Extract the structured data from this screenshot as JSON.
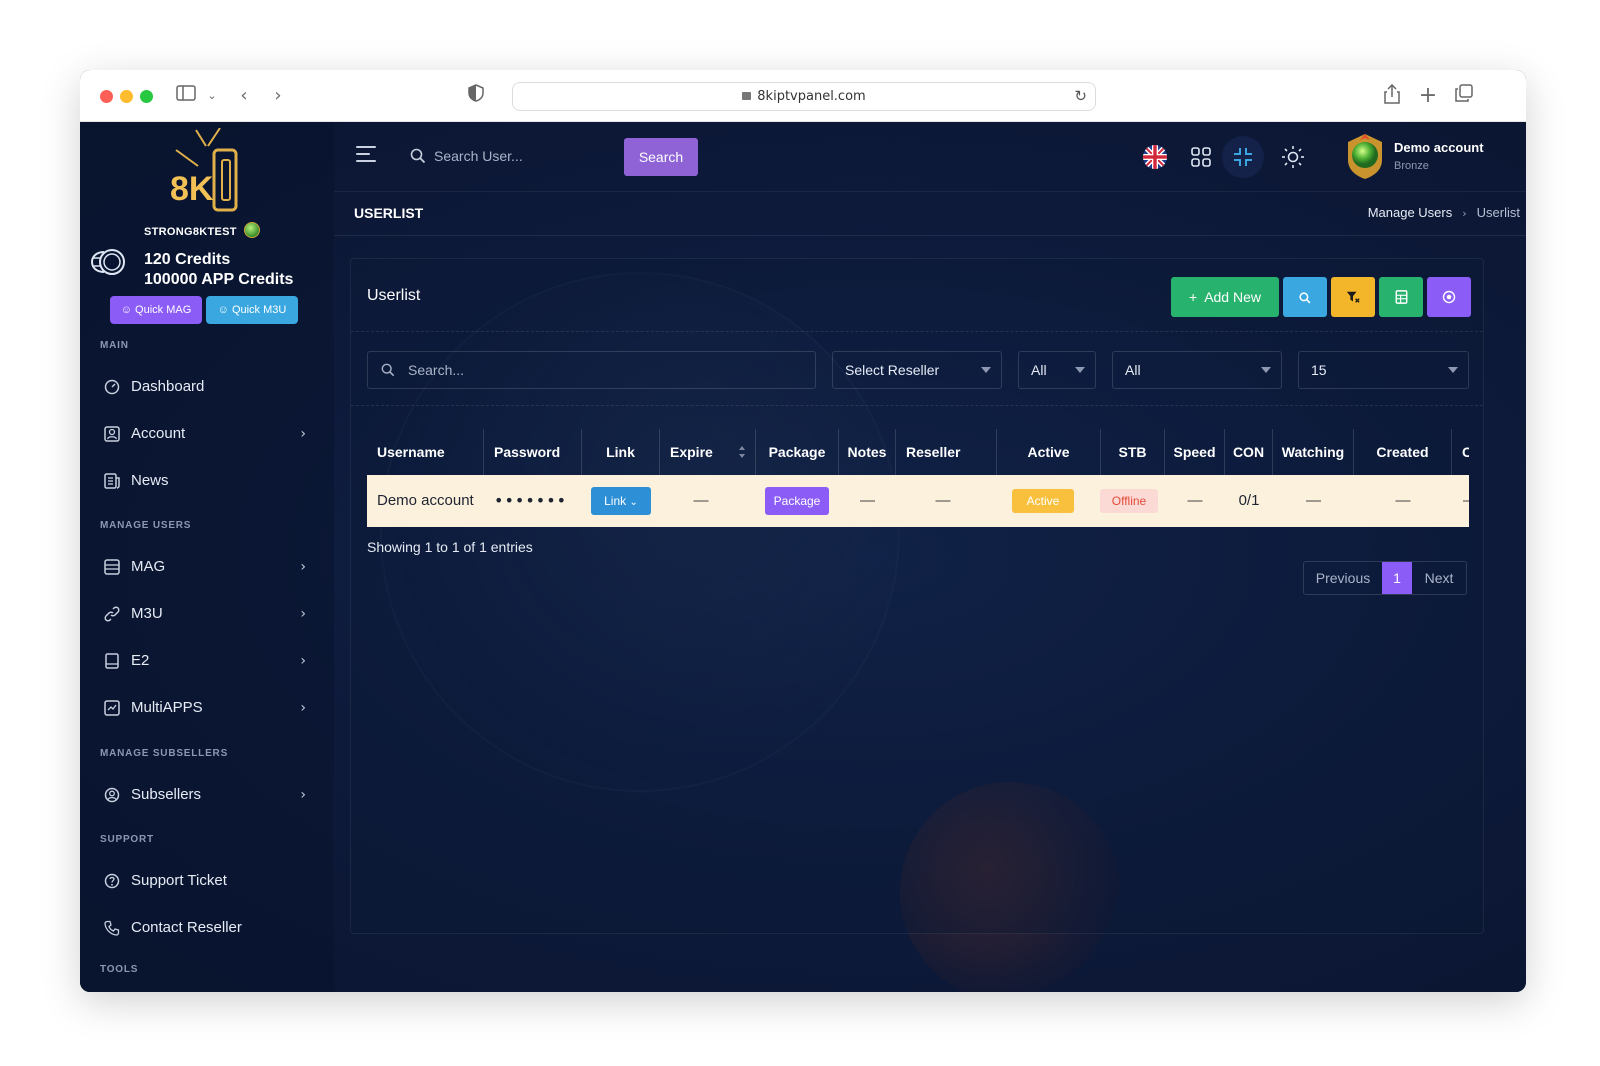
{
  "browser": {
    "url": "8kiptvpanel.com"
  },
  "sidebar": {
    "logo_text": "8K",
    "brand": "STRONG8KTEST",
    "credits": "120 Credits",
    "app_credits": "100000 APP Credits",
    "quick_mag": "Quick MAG",
    "quick_m3u": "Quick M3U",
    "sections": {
      "main": "MAIN",
      "manage_users": "MANAGE USERS",
      "manage_subsellers": "MANAGE SUBSELLERS",
      "support": "SUPPORT",
      "tools": "TOOLS"
    },
    "items": [
      {
        "label": "Dashboard",
        "icon": "dashboard-icon",
        "has_children": false
      },
      {
        "label": "Account",
        "icon": "account-icon",
        "has_children": true
      },
      {
        "label": "News",
        "icon": "news-icon",
        "has_children": false
      },
      {
        "label": "MAG",
        "icon": "mag-icon",
        "has_children": true
      },
      {
        "label": "M3U",
        "icon": "link-icon",
        "has_children": true
      },
      {
        "label": "E2",
        "icon": "e2-icon",
        "has_children": true
      },
      {
        "label": "MultiAPPS",
        "icon": "multiapps-icon",
        "has_children": true
      },
      {
        "label": "Subsellers",
        "icon": "user-circle-icon",
        "has_children": true
      },
      {
        "label": "Support Ticket",
        "icon": "help-circle-icon",
        "has_children": false
      },
      {
        "label": "Contact Reseller",
        "icon": "phone-icon",
        "has_children": false
      }
    ]
  },
  "topbar": {
    "search_placeholder": "Search User...",
    "search_button": "Search",
    "user_name": "Demo account",
    "user_rank": "Bronze"
  },
  "page": {
    "title": "USERLIST",
    "breadcrumb": [
      "Manage Users",
      "Userlist"
    ]
  },
  "card": {
    "title": "Userlist",
    "add_new": "Add New",
    "filters": {
      "search_placeholder": "Search...",
      "reseller": "Select Reseller",
      "status": "All",
      "type": "All",
      "page_size": "15"
    },
    "columns": [
      "Username",
      "Password",
      "Link",
      "Expire",
      "Package",
      "Notes",
      "Reseller",
      "Active",
      "STB",
      "Speed",
      "CON",
      "Watching",
      "Created",
      "C"
    ],
    "rows": [
      {
        "username": "Demo account",
        "password": "•••••••",
        "link": "Link",
        "expire": "—",
        "package": "Package",
        "notes": "—",
        "reseller": "—",
        "active": "Active",
        "stb": "Offline",
        "speed": "—",
        "con": "0/1",
        "watching": "—",
        "created": "—",
        "extra": "—"
      }
    ],
    "showing": "Showing 1 to 1 of 1 entries",
    "pagination": {
      "previous": "Previous",
      "current": "1",
      "next": "Next"
    }
  },
  "colors": {
    "background": "#0d1a3a",
    "accent_purple": "#8b5cf6",
    "accent_green": "#27b26d",
    "accent_blue": "#3aa7e0",
    "accent_yellow": "#f3b529",
    "row_highlight": "#fcf1dc"
  }
}
